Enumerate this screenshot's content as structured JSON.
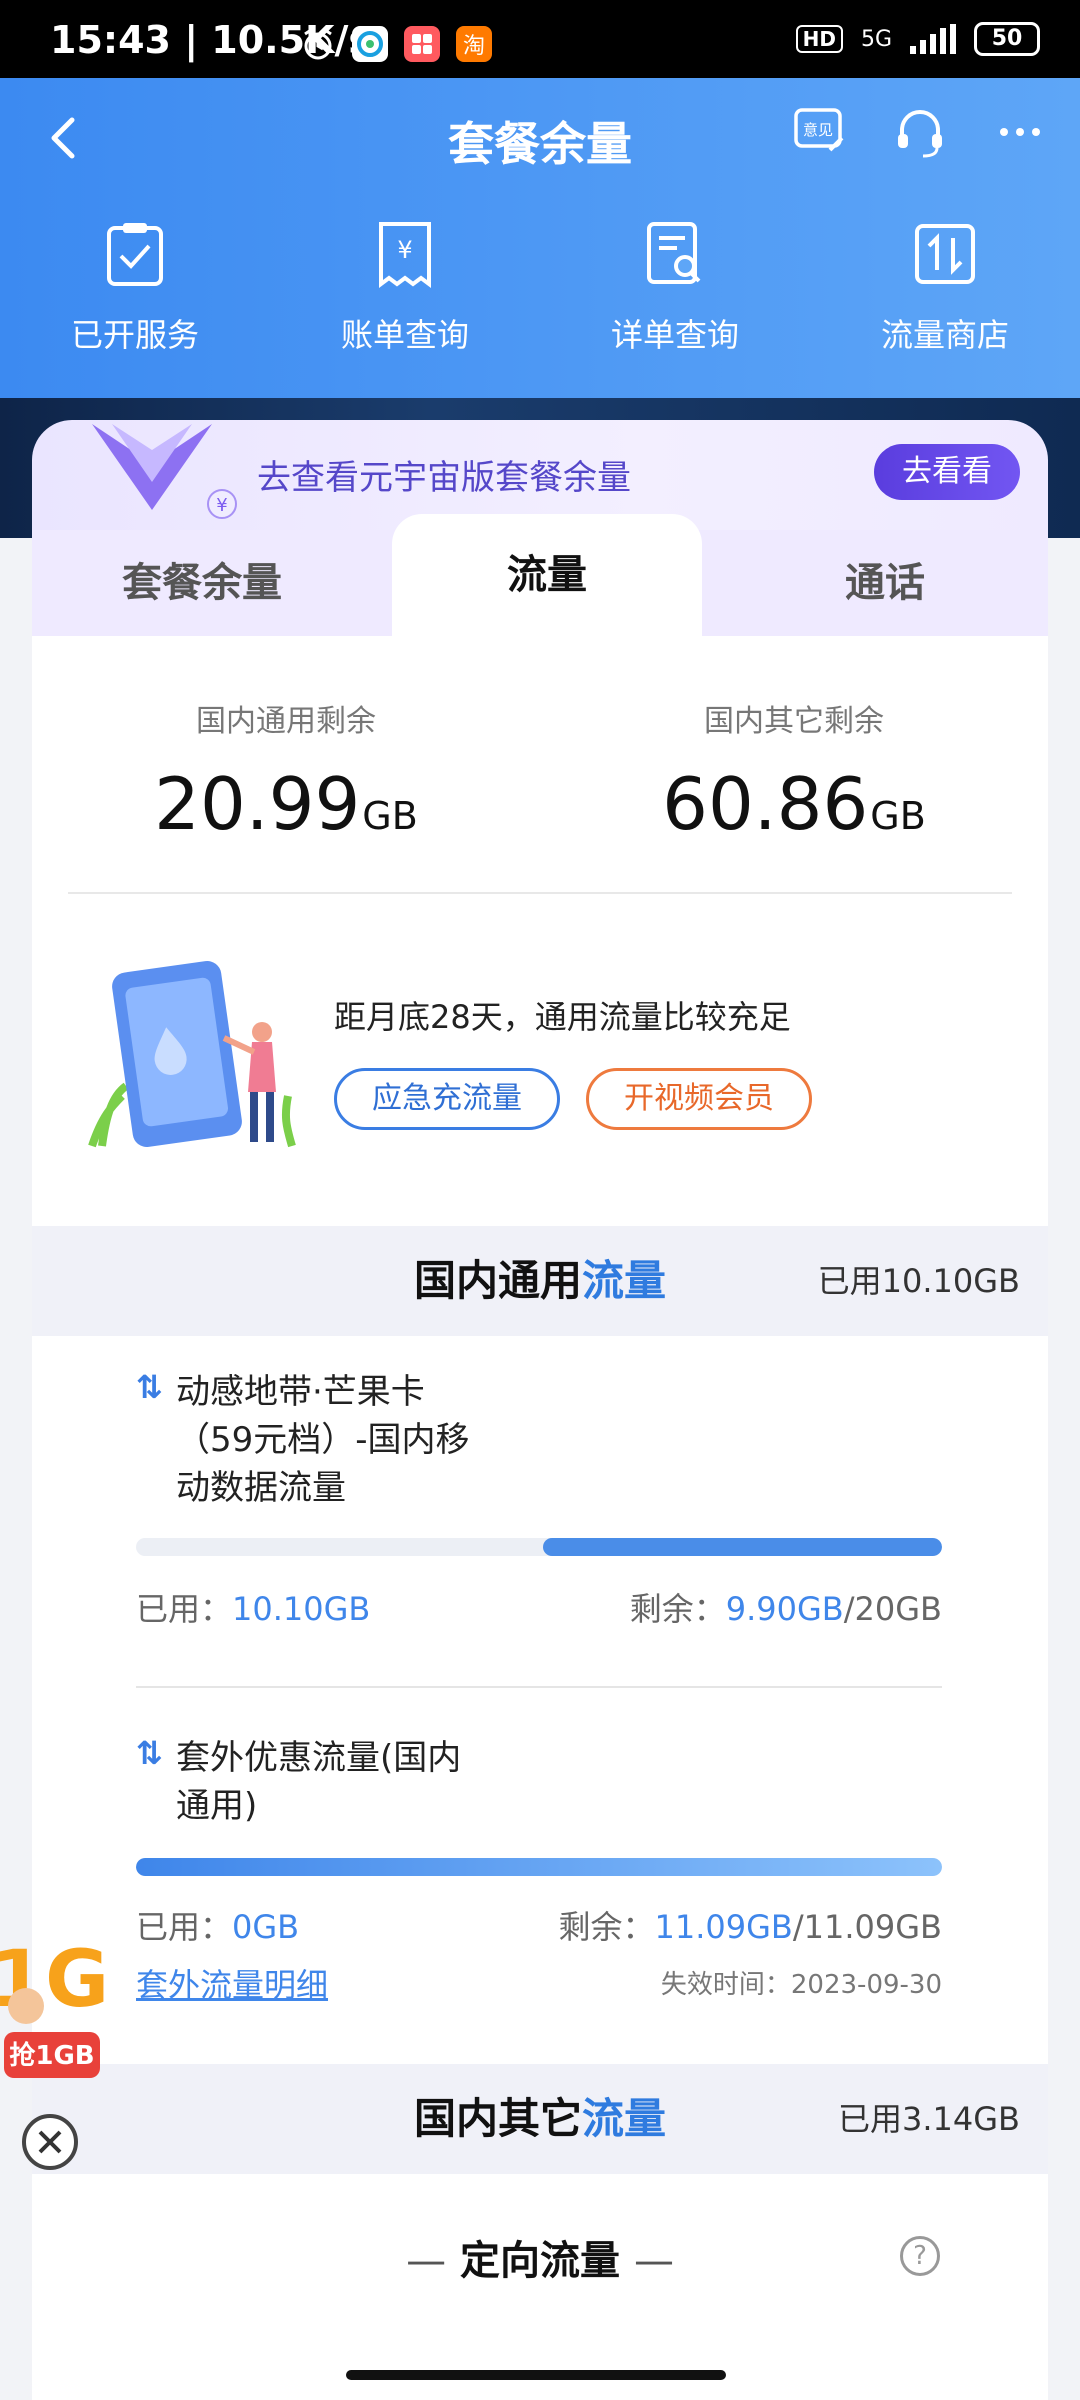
{
  "status_bar": {
    "time": "15:43 | 10.5K/s",
    "hd": "HD",
    "network": "5G",
    "battery": "50"
  },
  "header": {
    "title": "套餐余量",
    "feedback_icon_label": "意见"
  },
  "quick_actions": [
    {
      "icon": "clipboard-check-icon",
      "label": "已开服务"
    },
    {
      "icon": "receipt-yen-icon",
      "label": "账单查询"
    },
    {
      "icon": "document-search-icon",
      "label": "详单查询"
    },
    {
      "icon": "data-transfer-icon",
      "label": "流量商店"
    }
  ],
  "promo": {
    "text": "去查看元宇宙版套餐余量",
    "button": "去看看"
  },
  "tabs": [
    "套餐余量",
    "流量",
    "通话"
  ],
  "remain": {
    "general_label": "国内通用剩余",
    "general_value": "20.99",
    "general_unit": "GB",
    "other_label": "国内其它剩余",
    "other_value": "60.86",
    "other_unit": "GB",
    "tip": "距月底28天，通用流量比较充足",
    "btn_emergency": "应急充流量",
    "btn_video": "开视频会员"
  },
  "section_general": {
    "title_a": "国内通用",
    "title_b": "流量",
    "used": "已用10.10GB"
  },
  "packages": [
    {
      "arrows": "⇅",
      "name": "动感地带·芒果卡（59元档）-国内移动数据流量",
      "used_label": "已用：",
      "used_value": "10.10GB",
      "remain_label": "剩余：",
      "remain_value": "9.90GB",
      "total": "/20GB",
      "remaining_fraction": 0.495
    },
    {
      "arrows": "⇅",
      "name": "套外优惠流量(国内通用)",
      "used_label": "已用：",
      "used_value": "0GB",
      "remain_label": "剩余：",
      "remain_value": "11.09GB",
      "total": "/11.09GB",
      "remaining_fraction": 1.0,
      "link": "套外流量明细",
      "expiry": "失效时间：2023-09-30"
    }
  ],
  "section_other": {
    "title_a": "国内其它",
    "title_b": "流量",
    "used": "已用3.14GB"
  },
  "directed": {
    "dash_left": "—",
    "title": "定向流量",
    "dash_right": "—",
    "help": "?"
  },
  "float_badge": {
    "text": "抢1GB",
    "big": "1G"
  }
}
